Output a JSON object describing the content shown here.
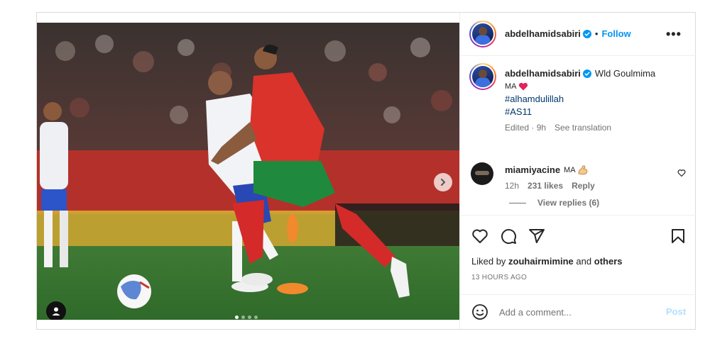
{
  "post": {
    "author": "abdelhamidsabiri",
    "follow_label": "Follow",
    "separator": "•",
    "more_label": "•••",
    "carousel_total": 4,
    "carousel_active": 1
  },
  "caption": {
    "author": "abdelhamidsabiri",
    "text": "Wld Goulmima",
    "line2": "MA",
    "hashtag1": "#alhamdulillah",
    "hashtag2": "#AS11",
    "edited": "Edited · 9h",
    "see_translation": "See translation"
  },
  "comment": {
    "author": "miamiyacine",
    "text": "MA",
    "time": "12h",
    "likes": "231 likes",
    "reply": "Reply",
    "view_replies": "View replies (6)"
  },
  "engagement": {
    "liked_by_prefix": "Liked by",
    "liked_by_user": "zouhairmimine",
    "liked_by_and": "and",
    "liked_by_others": "others",
    "timestamp": "13 HOURS AGO"
  },
  "composer": {
    "placeholder": "Add a comment...",
    "post_label": "Post"
  },
  "colors": {
    "link_blue": "#0095f6",
    "hashtag": "#00376b",
    "verified": "#0095f6",
    "heart_emoji": "#e0245e"
  },
  "icons": [
    "chevron-right-icon",
    "user-tag-icon",
    "verified-icon",
    "more-icon",
    "heart-icon",
    "comment-icon",
    "share-icon",
    "bookmark-icon",
    "emoji-icon"
  ]
}
